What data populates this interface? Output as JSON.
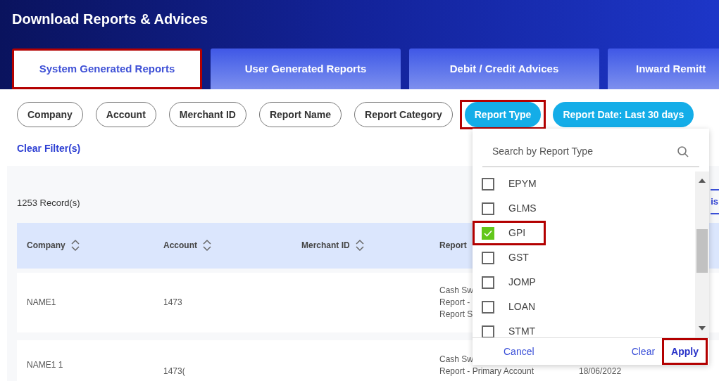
{
  "page_title": "Download Reports & Advices",
  "tabs": [
    {
      "label": "System Generated Reports",
      "selected": true,
      "highlighted": true
    },
    {
      "label": "User Generated Reports",
      "selected": false,
      "highlighted": false
    },
    {
      "label": "Debit / Credit Advices",
      "selected": false,
      "highlighted": false
    },
    {
      "label": "Inward Remitt",
      "selected": false,
      "highlighted": false
    }
  ],
  "filters": [
    {
      "label": "Company",
      "active": false,
      "highlighted": false
    },
    {
      "label": "Account",
      "active": false,
      "highlighted": false
    },
    {
      "label": "Merchant ID",
      "active": false,
      "highlighted": false
    },
    {
      "label": "Report Name",
      "active": false,
      "highlighted": false
    },
    {
      "label": "Report Category",
      "active": false,
      "highlighted": false
    },
    {
      "label": "Report Type",
      "active": true,
      "highlighted": true
    },
    {
      "label": "Report Date: Last 30 days",
      "active": true,
      "highlighted": false
    }
  ],
  "clear_filters": "Clear Filter(s)",
  "records": "1253 Record(s)",
  "partial_tab": "is",
  "table": {
    "columns": [
      {
        "label": "Company",
        "sortable": true
      },
      {
        "label": "Account",
        "sortable": true
      },
      {
        "label": "Merchant ID",
        "sortable": true
      },
      {
        "label": "Report",
        "sortable": false
      }
    ],
    "rows": [
      {
        "company": [
          "NAME1"
        ],
        "account": [
          "1473"
        ],
        "report": [
          "Cash Sw",
          "Report -",
          "Report S"
        ]
      },
      {
        "company": [
          "NAME1 1"
        ],
        "account": [
          "1473("
        ],
        "report": [
          "Cash Sw",
          "Report - Primary Account"
        ],
        "column_5": [
          "18/06/2022"
        ]
      }
    ]
  },
  "dropdown": {
    "search_placeholder": "Search by Report Type",
    "options": [
      {
        "label": "EPYM",
        "checked": false,
        "highlighted": false
      },
      {
        "label": "GLMS",
        "checked": false,
        "highlighted": false
      },
      {
        "label": "GPI",
        "checked": true,
        "highlighted": true
      },
      {
        "label": "GST",
        "checked": false,
        "highlighted": false
      },
      {
        "label": "JOMP",
        "checked": false,
        "highlighted": false
      },
      {
        "label": "LOAN",
        "checked": false,
        "highlighted": false
      },
      {
        "label": "STMT",
        "checked": false,
        "highlighted": false
      }
    ],
    "buttons": [
      {
        "label": "Cancel",
        "kind": "cancel",
        "highlighted": false
      },
      {
        "label": "Clear",
        "kind": "clear",
        "highlighted": false
      },
      {
        "label": "Apply",
        "kind": "apply",
        "highlighted": true
      }
    ]
  }
}
